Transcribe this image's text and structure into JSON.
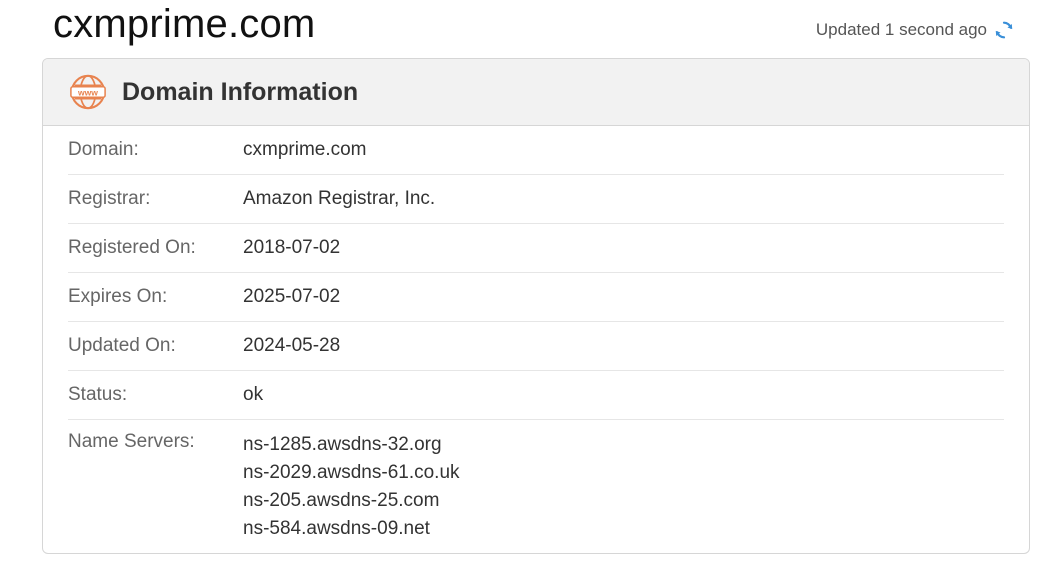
{
  "page": {
    "domain_title": "cxmprime.com",
    "updated_text": "Updated 1 second ago"
  },
  "panel": {
    "title": "Domain Information",
    "rows": [
      {
        "label": "Domain:",
        "value": "cxmprime.com"
      },
      {
        "label": "Registrar:",
        "value": "Amazon Registrar, Inc."
      },
      {
        "label": "Registered On:",
        "value": "2018-07-02"
      },
      {
        "label": "Expires On:",
        "value": "2025-07-02"
      },
      {
        "label": "Updated On:",
        "value": "2024-05-28"
      },
      {
        "label": "Status:",
        "value": "ok"
      }
    ],
    "name_servers_label": "Name Servers:",
    "name_servers": [
      "ns-1285.awsdns-32.org",
      "ns-2029.awsdns-61.co.uk",
      "ns-205.awsdns-25.com",
      "ns-584.awsdns-09.net"
    ]
  },
  "icons": {
    "header_icon": "www-globe-icon",
    "refresh_icon": "refresh-icon"
  },
  "colors": {
    "accent_orange": "#e8834f",
    "refresh_blue": "#3a8fd8",
    "header_bg": "#f2f2f2"
  }
}
